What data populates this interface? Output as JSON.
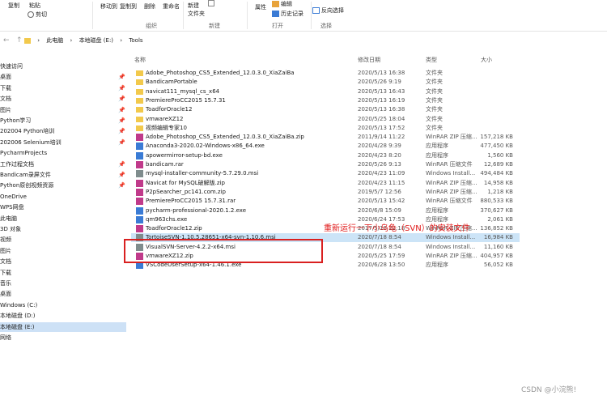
{
  "ribbon": {
    "copy": "复制",
    "paste": "粘贴",
    "cut": "剪切",
    "moveto": "移动到",
    "copyto": "复制到",
    "delete": "删除",
    "rename": "重命名",
    "newfolder": "新建\n文件夹",
    "edit": "编辑",
    "history": "历史记录",
    "props": "属性",
    "invert": "反向选择",
    "groups": {
      "org": "组织",
      "new": "新建",
      "open": "打开",
      "select": "选择"
    }
  },
  "breadcrumb": [
    "此电脑",
    "本地磁盘 (E:)",
    "Tools"
  ],
  "sidebar": [
    {
      "label": "快速访问",
      "pin": false
    },
    {
      "label": "桌面",
      "pin": true
    },
    {
      "label": "下载",
      "pin": true
    },
    {
      "label": "文档",
      "pin": true
    },
    {
      "label": "图片",
      "pin": true
    },
    {
      "label": "Python学习",
      "pin": true
    },
    {
      "label": "202004 Python培训",
      "pin": true
    },
    {
      "label": "202006 Selenium培训",
      "pin": true
    },
    {
      "label": "PycharmProjects",
      "pin": false
    },
    {
      "label": "工作过程文档",
      "pin": true
    },
    {
      "label": "Bandicam录屏文件",
      "pin": true
    },
    {
      "label": "Python原创视频资源",
      "pin": true
    },
    {
      "label": "OneDrive",
      "pin": false
    },
    {
      "label": "WPS网盘",
      "pin": false
    },
    {
      "label": "此电脑",
      "pin": false
    },
    {
      "label": "3D 对象",
      "pin": false
    },
    {
      "label": "视频",
      "pin": false
    },
    {
      "label": "图片",
      "pin": false
    },
    {
      "label": "文档",
      "pin": false
    },
    {
      "label": "下载",
      "pin": false
    },
    {
      "label": "音乐",
      "pin": false
    },
    {
      "label": "桌面",
      "pin": false
    },
    {
      "label": "Windows (C:)",
      "pin": false
    },
    {
      "label": "本地磁盘 (D:)",
      "pin": false
    },
    {
      "label": "本地磁盘 (E:)",
      "pin": false
    },
    {
      "label": "网络",
      "pin": false
    }
  ],
  "pin_glyph": "📌",
  "columns": {
    "name": "名称",
    "date": "修改日期",
    "type": "类型",
    "size": "大小"
  },
  "files": [
    {
      "name": "Adobe_Photoshop_CS5_Extended_12.0.3.0_XiaZaiBa",
      "date": "2020/5/13 16:38",
      "type": "文件夹",
      "size": "",
      "icon": "folder"
    },
    {
      "name": "BandicamPortable",
      "date": "2020/5/26 9:19",
      "type": "文件夹",
      "size": "",
      "icon": "folder"
    },
    {
      "name": "navicat111_mysql_cs_x64",
      "date": "2020/5/13 16:43",
      "type": "文件夹",
      "size": "",
      "icon": "folder"
    },
    {
      "name": "PremiereProCC2015 15.7.31",
      "date": "2020/5/13 16:19",
      "type": "文件夹",
      "size": "",
      "icon": "folder"
    },
    {
      "name": "ToadforOracle12",
      "date": "2020/5/13 16:38",
      "type": "文件夹",
      "size": "",
      "icon": "folder"
    },
    {
      "name": "vmwareXZ12",
      "date": "2020/5/25 18:04",
      "type": "文件夹",
      "size": "",
      "icon": "folder"
    },
    {
      "name": "视频编辑专家10",
      "date": "2020/5/13 17:52",
      "type": "文件夹",
      "size": "",
      "icon": "folder"
    },
    {
      "name": "Adobe_Photoshop_CS5_Extended_12.0.3.0_XiaZaiBa.zip",
      "date": "2011/9/14 11:22",
      "type": "WinRAR ZIP 压缩...",
      "size": "157,218 KB",
      "icon": "rar"
    },
    {
      "name": "Anaconda3-2020.02-Windows-x86_64.exe",
      "date": "2020/4/28 9:39",
      "type": "应用程序",
      "size": "477,450 KB",
      "icon": "exe"
    },
    {
      "name": "apowermirror-setup-bd.exe",
      "date": "2020/4/23 8:20",
      "type": "应用程序",
      "size": "1,560 KB",
      "icon": "exe"
    },
    {
      "name": "bandicam.rar",
      "date": "2020/5/26 9:13",
      "type": "WinRAR 压缩文件",
      "size": "12,689 KB",
      "icon": "rar"
    },
    {
      "name": "mysql-installer-community-5.7.29.0.msi",
      "date": "2020/4/23 11:09",
      "type": "Windows Install...",
      "size": "494,484 KB",
      "icon": "msi"
    },
    {
      "name": "Navicat for MySQL破解版.zip",
      "date": "2020/4/23 11:15",
      "type": "WinRAR ZIP 压缩...",
      "size": "14,958 KB",
      "icon": "rar"
    },
    {
      "name": "P2pSearcher_pc141.com.zip",
      "date": "2019/5/7 12:56",
      "type": "WinRAR ZIP 压缩...",
      "size": "1,218 KB",
      "icon": "rar"
    },
    {
      "name": "PremiereProCC2015 15.7.31.rar",
      "date": "2020/5/13 15:42",
      "type": "WinRAR 压缩文件",
      "size": "880,533 KB",
      "icon": "rar"
    },
    {
      "name": "pycharm-professional-2020.1.2.exe",
      "date": "2020/6/8 15:09",
      "type": "应用程序",
      "size": "370,627 KB",
      "icon": "exe"
    },
    {
      "name": "qm963chs.exe",
      "date": "2020/6/24 17:53",
      "type": "应用程序",
      "size": "2,061 KB",
      "icon": "exe"
    },
    {
      "name": "ToadforOracle12.zip",
      "date": "2017/5/18 22:18",
      "type": "WinRAR ZIP 压缩...",
      "size": "136,852 KB",
      "icon": "rar"
    },
    {
      "name": "TortoiseSVN-1.10.5.28651-x64-svn-1.10.6.msi",
      "date": "2020/7/18 8:54",
      "type": "Windows Install...",
      "size": "16,984 KB",
      "icon": "msi",
      "selected": true
    },
    {
      "name": "VisualSVN-Server-4.2.2-x64.msi",
      "date": "2020/7/18 8:54",
      "type": "Windows Install...",
      "size": "11,160 KB",
      "icon": "msi"
    },
    {
      "name": "vmwareXZ12.zip",
      "date": "2020/5/25 17:59",
      "type": "WinRAR ZIP 压缩...",
      "size": "404,957 KB",
      "icon": "rar"
    },
    {
      "name": "VSCodeUserSetup-x64-1.46.1.exe",
      "date": "2020/6/28 13:50",
      "type": "应用程序",
      "size": "56,052 KB",
      "icon": "exe"
    }
  ],
  "annotation": "重新运行一下小乌龟（SVN）的安装文件",
  "watermark": "CSDN @小浣熊!",
  "colors": {
    "folder": "#f2c94c",
    "rar": "#c03a8a",
    "exe": "#3a7bd5",
    "msi": "#7f8c8d",
    "accent": "#e01818"
  }
}
